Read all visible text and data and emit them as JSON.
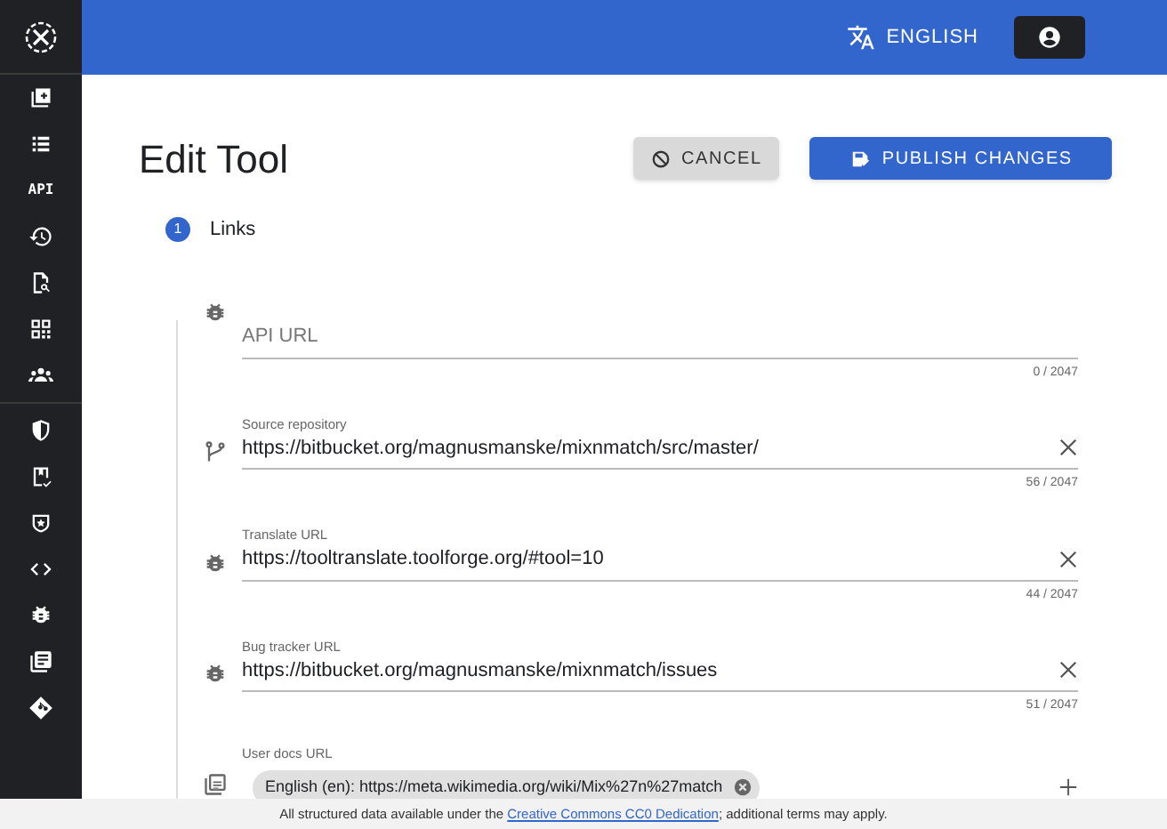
{
  "topbar": {
    "language": "ENGLISH"
  },
  "sidebar": {
    "api_label": "API"
  },
  "page": {
    "title": "Edit Tool",
    "cancel": "CANCEL",
    "publish": "PUBLISH CHANGES"
  },
  "step": {
    "number": "1",
    "label": "Links"
  },
  "fields": [
    {
      "kind": "text",
      "placeholder": "API URL",
      "counter": "0 / 2047"
    },
    {
      "kind": "text",
      "label": "Source repository",
      "value": "https://bitbucket.org/magnusmanske/mixnmatch/src/master/",
      "counter": "56 / 2047"
    },
    {
      "kind": "text",
      "label": "Translate URL",
      "value": "https://tooltranslate.toolforge.org/#tool=10",
      "counter": "44 / 2047"
    },
    {
      "kind": "text",
      "label": "Bug tracker URL",
      "value": "https://bitbucket.org/magnusmanske/mixnmatch/issues",
      "counter": "51 / 2047"
    },
    {
      "kind": "chips",
      "label": "User docs URL",
      "chips": [
        "English (en): https://meta.wikimedia.org/wiki/Mix%27n%27match"
      ]
    }
  ],
  "footer": {
    "before": "All structured data available under the ",
    "link": "Creative Commons CC0 Dedication",
    "after": "; additional terms may apply."
  }
}
